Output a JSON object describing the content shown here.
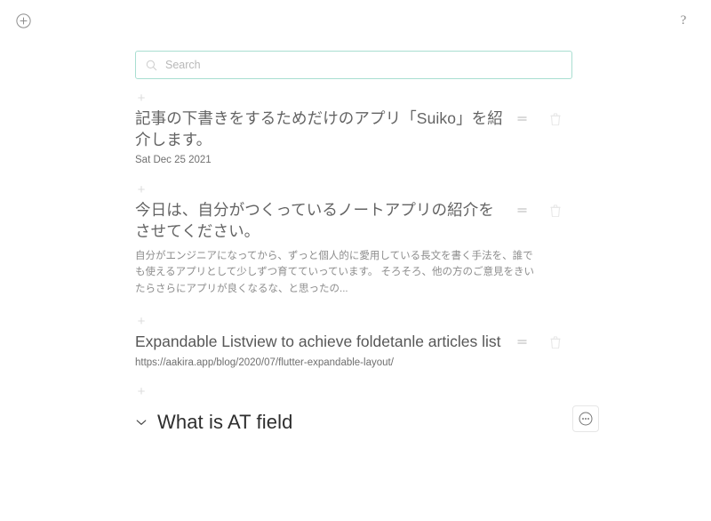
{
  "app": {
    "background": "#ffffff",
    "accent": "#a9ded1"
  },
  "topbar": {
    "add_icon": "add-circle-icon",
    "add_label": "",
    "help_icon": "help-icon",
    "help_label": "?"
  },
  "search": {
    "icon": "search-icon",
    "placeholder": "Search",
    "value": "",
    "border_color": "#a9ded1"
  },
  "add_divider": {
    "label": "+",
    "icon": "plus-icon"
  },
  "entries": [
    {
      "title": "記事の下書きをするためだけのアプリ「Suiko」を紹介します。",
      "meta": "Sat Dec 25 2021",
      "meta_kind": "date",
      "body": "",
      "drag_icon": "drag-handle-icon",
      "delete_icon": "delete-icon"
    },
    {
      "title": "今日は、自分がつくっているノートアプリの紹介をさせてください。",
      "meta": "",
      "meta_kind": "none",
      "body": "自分がエンジニアになってから、ずっと個人的に愛用している長文を書く手法を、誰でも使えるアプリとして少しずつ育てていっています。 そろそろ、他の方のご意見をきいたらさらにアプリが良くなるな、と思ったの...",
      "drag_icon": "drag-handle-icon",
      "delete_icon": "delete-icon"
    },
    {
      "title": "Expandable Listview to achieve foldetanle articles list",
      "meta": "https://aakira.app/blog/2020/07/flutter-expandable-layout/",
      "meta_kind": "url",
      "body": "",
      "drag_icon": "drag-handle-icon",
      "delete_icon": "delete-icon"
    }
  ],
  "section": {
    "chevron_icon": "chevron-down-icon",
    "title": "What is AT field",
    "more_icon": "more-options-icon",
    "more_label": ""
  }
}
